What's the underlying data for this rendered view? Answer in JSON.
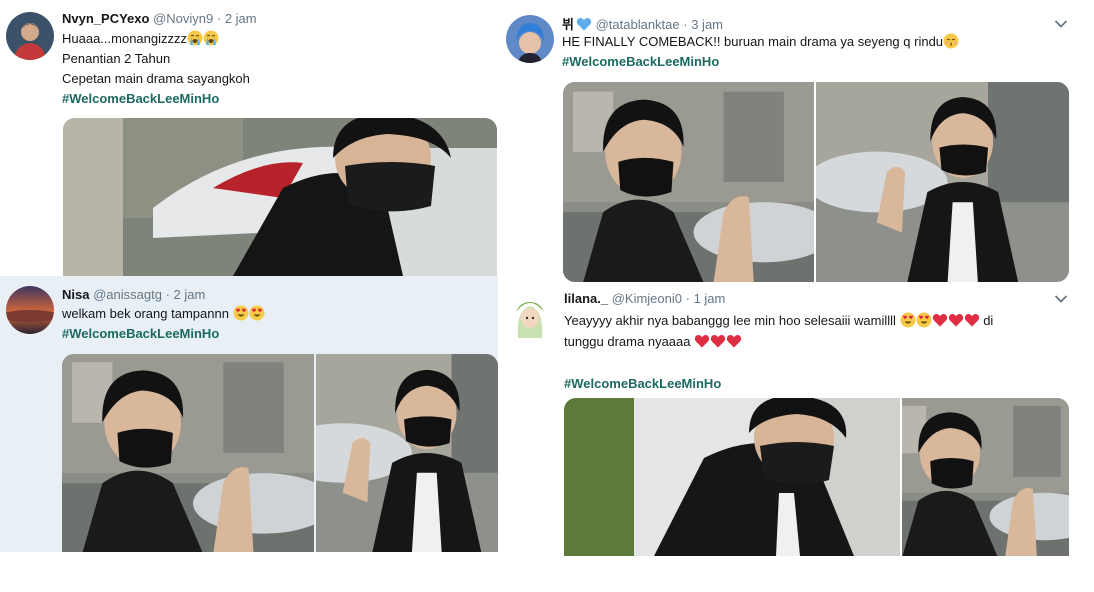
{
  "tweets": [
    {
      "id": "t1",
      "name": "Nvyn_PCYexo",
      "handle": "@Noviyn9",
      "separator": "·",
      "time": "2 jam",
      "line1": "Huaaa...monangizzzz",
      "line2": "Penantian 2 Tahun",
      "line3": "Cepetan main drama sayangkoh",
      "hashtag": "#WelcomeBackLeeMinHo"
    },
    {
      "id": "t2",
      "name": "Nisa",
      "handle": "@anissagtg",
      "separator": "·",
      "time": "2 jam",
      "line1": "welkam bek orang tampannn",
      "hashtag": "#WelcomeBackLeeMinHo"
    },
    {
      "id": "t3",
      "name": "뷔",
      "handle": "@tatablanktae",
      "separator": "·",
      "time": "3 jam",
      "line1": "HE FINALLY COMEBACK!! buruan main drama ya seyeng q rindu",
      "hashtag": "#WelcomeBackLeeMinHo"
    },
    {
      "id": "t4",
      "name": "lilana._",
      "handle": "@Kimjeoni0",
      "separator": "·",
      "time": "1 jam",
      "line1": "Yeayyyy akhir nya babanggg lee min hoo selesaiii wamillll",
      "line1_tail": "di",
      "line2": "tunggu drama nyaaaa",
      "hashtag": "#WelcomeBackLeeMinHo"
    }
  ],
  "icons": {
    "chevron": "chevron-down-icon",
    "emoji_crying": "loudly-crying-face-emoji",
    "emoji_heart_eyes": "heart-eyes-emoji",
    "emoji_heart": "red-heart-emoji",
    "emoji_kiss": "kissing-face-emoji",
    "emoji_blue_heart": "blue-heart-emoji"
  },
  "colors": {
    "hashtag": "#1c6a61",
    "muted": "#657786",
    "highlight_bg": "#e8f0f6"
  }
}
